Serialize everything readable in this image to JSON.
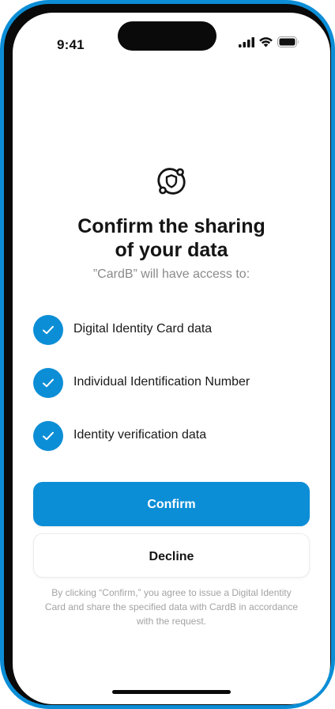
{
  "status_bar": {
    "time": "9:41",
    "icons": [
      "signal-icon",
      "wifi-icon",
      "battery-icon"
    ]
  },
  "hero": {
    "icon": "data-sharing-shield-icon",
    "title_line1": "Confirm the sharing",
    "title_line2": "of your data",
    "subtitle": "”CardB” will have access to:"
  },
  "access_items": [
    {
      "label": "Digital Identity Card data",
      "icon": "check-icon"
    },
    {
      "label": "Individual Identification Number",
      "icon": "check-icon"
    },
    {
      "label": "Identity verification data",
      "icon": "check-icon"
    }
  ],
  "buttons": {
    "confirm_label": "Confirm",
    "decline_label": "Decline"
  },
  "disclaimer": "By clicking “Confirm,” you agree to issue a Digital Identity Card and share the specified data with CardB in accordance with the request.",
  "colors": {
    "accent": "#0c8ed6",
    "frame": "#0c8ed6",
    "text_primary": "#141414",
    "text_muted": "#8a8a8a"
  }
}
